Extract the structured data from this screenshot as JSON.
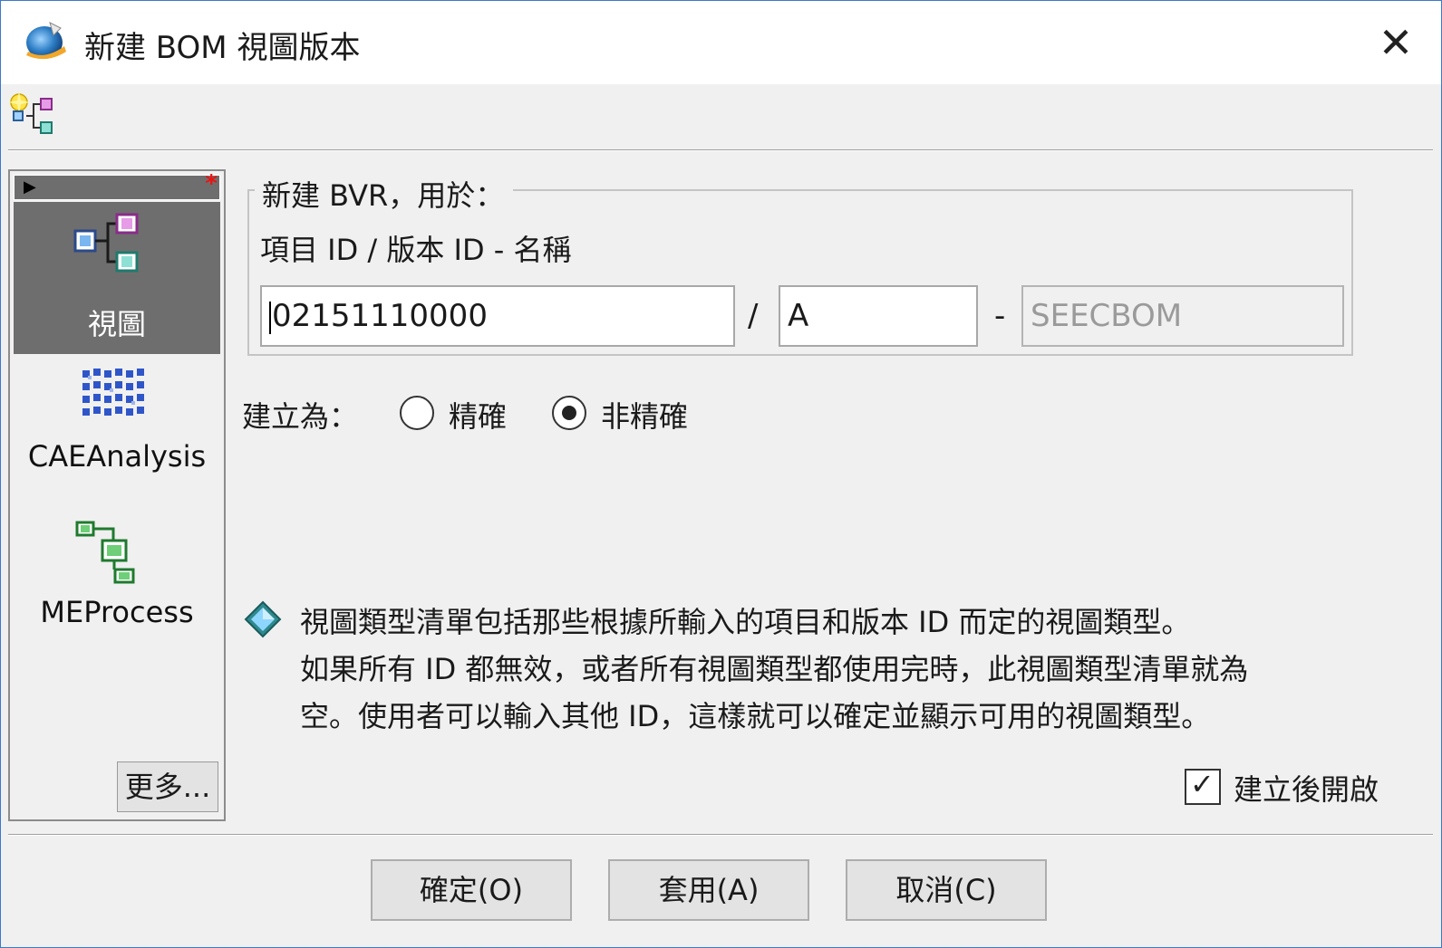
{
  "window": {
    "title": "新建 BOM 視圖版本",
    "close_symbol": "✕",
    "app_icon": "teamcenter-app-icon"
  },
  "toolbar": {
    "icons": [
      "new-structure-icon"
    ]
  },
  "sidebar": {
    "items": [
      {
        "label": "視圖",
        "icon": "view-structure-icon",
        "selected": true
      },
      {
        "label": "CAEAnalysis",
        "icon": "cae-analysis-icon",
        "selected": false
      },
      {
        "label": "MEProcess",
        "icon": "me-process-icon",
        "selected": false
      }
    ],
    "more_label": "更多...",
    "required_marker": "*"
  },
  "form": {
    "group_title": "新建 BVR，用於：",
    "field_label": "項目 ID / 版本 ID - 名稱",
    "item_id": "02151110000",
    "slash": "/",
    "revision_id": "A",
    "dash": "-",
    "name": "SEECBOM",
    "create_as_label": "建立為：",
    "radio_options": [
      {
        "label": "精確",
        "checked": false
      },
      {
        "label": "非精確",
        "checked": true
      }
    ],
    "info_lines": [
      "視圖類型清單包括那些根據所輸入的項目和版本 ID 而定的視圖類型。",
      "如果所有 ID 都無效，或者所有視圖類型都使用完時，此視圖類型清單就為",
      "空。使用者可以輸入其他 ID，這樣就可以確定並顯示可用的視圖類型。"
    ],
    "open_after_create_label": "建立後開啟",
    "open_after_create_checked": true
  },
  "buttons": {
    "ok": "確定(O)",
    "apply": "套用(A)",
    "cancel": "取消(C)"
  },
  "colors": {
    "window_border": "#3c78c8",
    "selected_bg": "#6e6e6e",
    "required_star": "#e11111"
  }
}
